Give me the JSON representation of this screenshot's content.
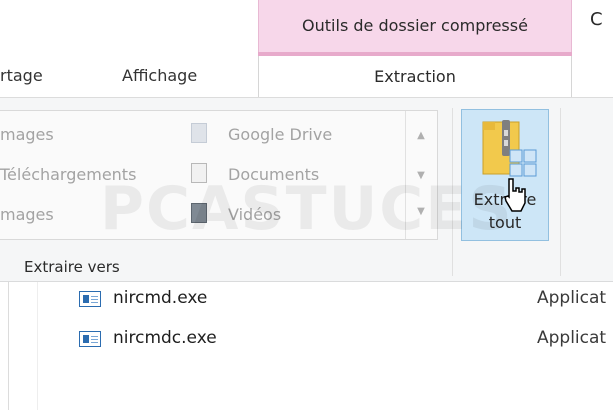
{
  "ribbon": {
    "context_tab_title": "Outils de dossier compressé",
    "edge_letter": "C",
    "tabs": [
      {
        "label": "rtage"
      },
      {
        "label": "Affichage"
      },
      {
        "label": "Extraction"
      }
    ],
    "gallery": {
      "col1": [
        "mages",
        "Téléchargements",
        "mages"
      ],
      "col2": [
        "Google Drive",
        "Documents",
        "Vidéos"
      ],
      "icons": [
        "folder-icon",
        "documents-icon",
        "videos-icon"
      ]
    },
    "group_label": "Extraire vers",
    "extract_button": {
      "line1": "Extraire",
      "line2": "tout"
    }
  },
  "files": [
    {
      "name": "nircmd.exe",
      "type": "Applicat"
    },
    {
      "name": "nircmdc.exe",
      "type": "Applicat"
    }
  ],
  "watermark": "PCASTUCES",
  "colors": {
    "context_pink": "#f7d7ea",
    "context_strip": "#e7aacb",
    "selected_button_bg": "#cde6f7",
    "selected_button_border": "#92c0e0"
  }
}
